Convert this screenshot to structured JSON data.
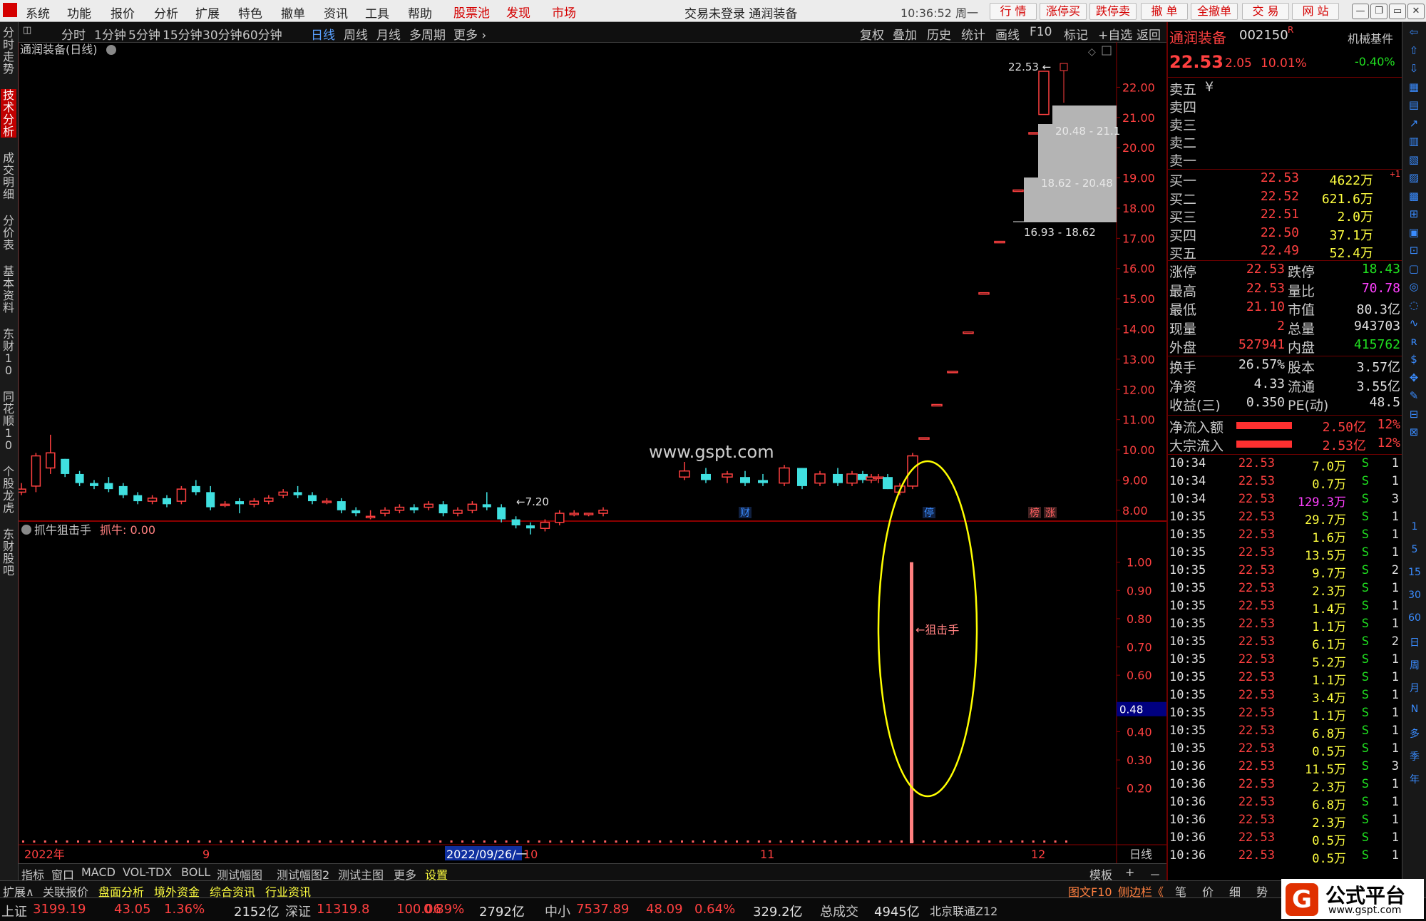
{
  "menubar": {
    "items": [
      "系统",
      "功能",
      "报价",
      "分析",
      "扩展",
      "特色",
      "撤单",
      "资讯",
      "工具",
      "帮助"
    ],
    "red_items": [
      "股票池",
      "发现",
      "市场"
    ],
    "title": "交易未登录  通润装备",
    "clock": "10:36:52 周一",
    "buttons": [
      "行 情",
      "涨停买",
      "跌停卖",
      "撤 单",
      "全撤单",
      "交 易",
      "网 站"
    ],
    "win_buttons": [
      "—",
      "❐",
      "▭",
      "✕"
    ]
  },
  "left_tabs": [
    "分时走势",
    "技术分析",
    "成交明细",
    "分价表",
    "基本资料",
    "东财10",
    "同花顺10",
    "个股龙虎",
    "东财股吧"
  ],
  "periods": [
    "分时",
    "1分钟",
    "5分钟",
    "15分钟",
    "30分钟",
    "60分钟",
    "日线",
    "周线",
    "月线",
    "多周期",
    "更多"
  ],
  "active_period": "日线",
  "chart_tools": [
    "复权",
    "叠加",
    "历史",
    "统计",
    "画线",
    "F10",
    "标记",
    "+自选",
    "返回"
  ],
  "chart_data": [
    {
      "type": "candlestick",
      "title": "通润装备(日线)",
      "ylim": [
        7.5,
        22.6
      ],
      "yticks": [
        "22.00",
        "21.00",
        "20.00",
        "19.00",
        "18.00",
        "17.00",
        "16.00",
        "15.00",
        "14.00",
        "13.00",
        "12.00",
        "11.00",
        "10.00",
        "9.00",
        "8.00"
      ],
      "annotations": {
        "high": "22.53",
        "low": "7.20",
        "box1": "20.48 - 21.1",
        "box2": "18.62 - 20.48",
        "box3": "16.93 - 18.62",
        "watermark": "www.gspt.com"
      },
      "markers": [
        "财",
        "停",
        "榜",
        "涨"
      ],
      "candles": [
        [
          8.6,
          8.9,
          8.5,
          8.7
        ],
        [
          8.8,
          9.9,
          8.6,
          9.8
        ],
        [
          9.4,
          10.5,
          9.2,
          9.9
        ],
        [
          9.7,
          9.7,
          9.1,
          9.2
        ],
        [
          9.2,
          9.3,
          8.8,
          8.9
        ],
        [
          8.9,
          9.0,
          8.7,
          8.8
        ],
        [
          8.9,
          9.1,
          8.6,
          8.7
        ],
        [
          8.8,
          8.9,
          8.4,
          8.5
        ],
        [
          8.5,
          8.6,
          8.2,
          8.3
        ],
        [
          8.3,
          8.5,
          8.2,
          8.4
        ],
        [
          8.4,
          8.5,
          8.1,
          8.2
        ],
        [
          8.3,
          8.8,
          8.2,
          8.7
        ],
        [
          8.8,
          9.0,
          8.5,
          8.6
        ],
        [
          8.6,
          8.8,
          8.0,
          8.1
        ],
        [
          8.2,
          8.3,
          8.1,
          8.2
        ],
        [
          8.3,
          8.4,
          7.9,
          8.2
        ],
        [
          8.2,
          8.4,
          8.1,
          8.3
        ],
        [
          8.3,
          8.5,
          8.2,
          8.4
        ],
        [
          8.5,
          8.7,
          8.4,
          8.6
        ],
        [
          8.6,
          8.8,
          8.4,
          8.5
        ],
        [
          8.5,
          8.6,
          8.2,
          8.3
        ],
        [
          8.3,
          8.4,
          8.2,
          8.3
        ],
        [
          8.3,
          8.4,
          7.9,
          8.0
        ],
        [
          8.0,
          8.1,
          7.8,
          7.9
        ],
        [
          7.8,
          8.0,
          7.7,
          7.8
        ],
        [
          7.9,
          8.1,
          7.8,
          8.0
        ],
        [
          8.0,
          8.2,
          7.9,
          8.1
        ],
        [
          8.1,
          8.2,
          7.9,
          8.0
        ],
        [
          8.1,
          8.3,
          8.0,
          8.2
        ],
        [
          8.2,
          8.3,
          7.8,
          7.9
        ],
        [
          7.9,
          8.1,
          7.8,
          8.0
        ],
        [
          8.0,
          8.3,
          7.9,
          8.2
        ],
        [
          8.2,
          8.6,
          8.0,
          8.1
        ],
        [
          8.1,
          8.2,
          7.6,
          7.7
        ],
        [
          7.7,
          7.8,
          7.4,
          7.5
        ],
        [
          7.5,
          7.6,
          7.2,
          7.4
        ],
        [
          7.4,
          7.7,
          7.3,
          7.6
        ],
        [
          7.6,
          8.0,
          7.5,
          7.9
        ],
        [
          7.9,
          8.0,
          7.8,
          7.9
        ],
        [
          7.9,
          7.9,
          7.8,
          7.9
        ],
        [
          7.9,
          8.1,
          7.8,
          8.0
        ]
      ],
      "candles2": [
        [
          9.1,
          9.6,
          9.0,
          9.3
        ],
        [
          9.2,
          9.4,
          8.9,
          9.0
        ],
        [
          9.1,
          9.3,
          8.9,
          9.2
        ],
        [
          9.1,
          9.3,
          8.8,
          8.9
        ],
        [
          9.0,
          9.2,
          8.8,
          8.9
        ],
        [
          8.9,
          9.5,
          8.8,
          9.4
        ],
        [
          9.4,
          9.4,
          8.7,
          8.8
        ],
        [
          8.9,
          9.3,
          8.8,
          9.2
        ],
        [
          9.2,
          9.4,
          8.8,
          8.9
        ],
        [
          8.9,
          9.3,
          8.8,
          9.2
        ],
        [
          9.2,
          9.3,
          8.9,
          9.0
        ],
        [
          9.0,
          9.2,
          8.9,
          9.1
        ],
        [
          9.1,
          9.2,
          8.9,
          9.1
        ],
        [
          9.1,
          9.2,
          8.7,
          8.7
        ],
        [
          8.6,
          8.9,
          8.5,
          8.8
        ],
        [
          8.8,
          9.9,
          8.7,
          9.8
        ],
        [
          10.4,
          10.4,
          10.4,
          10.4
        ],
        [
          11.5,
          11.5,
          11.5,
          11.5
        ],
        [
          12.6,
          12.6,
          12.6,
          12.6
        ],
        [
          13.9,
          13.9,
          13.9,
          13.9
        ],
        [
          15.2,
          15.2,
          15.2,
          15.2
        ],
        [
          16.9,
          16.9,
          16.9,
          16.9
        ],
        [
          18.6,
          18.6,
          18.6,
          18.6
        ],
        [
          20.5,
          20.5,
          20.5,
          20.5
        ],
        [
          21.1,
          22.53,
          21.1,
          22.53
        ]
      ]
    },
    {
      "type": "bar",
      "title": "抓牛狙击手",
      "series_label": "抓牛: 0.00",
      "ylim": [
        0,
        1.1
      ],
      "yticks": [
        "1.00",
        "0.90",
        "0.80",
        "0.70",
        "0.60",
        "0.40",
        "0.30",
        "0.20"
      ],
      "current_value": "0.48",
      "signal_value": 1.0,
      "signal_label": "←狙击手",
      "xlabels": [
        "2022年",
        "9",
        "2022/09/26/一",
        "10",
        "11",
        "12"
      ],
      "subchart_label": "日线"
    }
  ],
  "quote": {
    "name": "通润装备",
    "code": "002150",
    "code_flag": "R",
    "sector": "机械基件",
    "sector_change": "-0.40%",
    "price": "22.53",
    "change": "2.05",
    "pct": "10.01%",
    "asks": [
      {
        "l": "卖五",
        "p": "",
        "v": "¥"
      },
      {
        "l": "卖四",
        "p": "",
        "v": ""
      },
      {
        "l": "卖三",
        "p": "",
        "v": ""
      },
      {
        "l": "卖二",
        "p": "",
        "v": ""
      },
      {
        "l": "卖一",
        "p": "",
        "v": ""
      }
    ],
    "bids": [
      {
        "l": "买一",
        "p": "22.53",
        "v": "4622万",
        "x": "+1"
      },
      {
        "l": "买二",
        "p": "22.52",
        "v": "621.6万",
        "x": ""
      },
      {
        "l": "买三",
        "p": "22.51",
        "v": "2.0万",
        "x": ""
      },
      {
        "l": "买四",
        "p": "22.50",
        "v": "37.1万",
        "x": ""
      },
      {
        "l": "买五",
        "p": "22.49",
        "v": "52.4万",
        "x": ""
      }
    ],
    "stats": [
      {
        "l1": "涨停",
        "v1": "22.53",
        "l2": "跌停",
        "v2": "18.43"
      },
      {
        "l1": "最高",
        "v1": "22.53",
        "l2": "量比",
        "v2": "70.78"
      },
      {
        "l1": "最低",
        "v1": "21.10",
        "l2": "市值",
        "v2": "80.3亿"
      },
      {
        "l1": "现量",
        "v1": "2",
        "l2": "总量",
        "v2": "943703"
      },
      {
        "l1": "外盘",
        "v1": "527941",
        "l2": "内盘",
        "v2": "415762"
      }
    ],
    "stats2": [
      {
        "l1": "换手",
        "v1": "26.57%",
        "l2": "股本",
        "v2": "3.57亿"
      },
      {
        "l1": "净资",
        "v1": "4.33",
        "l2": "流通",
        "v2": "3.55亿"
      },
      {
        "l1": "收益(三)",
        "v1": "0.350",
        "l2": "PE(动)",
        "v2": "48.5"
      }
    ],
    "flows": [
      {
        "l": "净流入额",
        "v": "2.50亿",
        "p": "12%"
      },
      {
        "l": "大宗流入",
        "v": "2.53亿",
        "p": "12%"
      }
    ],
    "ticks": [
      [
        "10:34",
        "22.53",
        "7.0万",
        "S",
        "1"
      ],
      [
        "10:34",
        "22.53",
        "0.7万",
        "S",
        "1"
      ],
      [
        "10:34",
        "22.53",
        "129.3万",
        "S",
        "3"
      ],
      [
        "10:35",
        "22.53",
        "29.7万",
        "S",
        "1"
      ],
      [
        "10:35",
        "22.53",
        "1.6万",
        "S",
        "1"
      ],
      [
        "10:35",
        "22.53",
        "13.5万",
        "S",
        "1"
      ],
      [
        "10:35",
        "22.53",
        "9.7万",
        "S",
        "2"
      ],
      [
        "10:35",
        "22.53",
        "2.3万",
        "S",
        "1"
      ],
      [
        "10:35",
        "22.53",
        "1.4万",
        "S",
        "1"
      ],
      [
        "10:35",
        "22.53",
        "1.1万",
        "S",
        "1"
      ],
      [
        "10:35",
        "22.53",
        "6.1万",
        "S",
        "2"
      ],
      [
        "10:35",
        "22.53",
        "5.2万",
        "S",
        "1"
      ],
      [
        "10:35",
        "22.53",
        "1.1万",
        "S",
        "1"
      ],
      [
        "10:35",
        "22.53",
        "3.4万",
        "S",
        "1"
      ],
      [
        "10:35",
        "22.53",
        "1.1万",
        "S",
        "1"
      ],
      [
        "10:35",
        "22.53",
        "6.8万",
        "S",
        "1"
      ],
      [
        "10:35",
        "22.53",
        "0.5万",
        "S",
        "1"
      ],
      [
        "10:36",
        "22.53",
        "11.5万",
        "S",
        "3"
      ],
      [
        "10:36",
        "22.53",
        "2.3万",
        "S",
        "1"
      ],
      [
        "10:36",
        "22.53",
        "6.8万",
        "S",
        "1"
      ],
      [
        "10:36",
        "22.53",
        "2.3万",
        "S",
        "1"
      ],
      [
        "10:36",
        "22.53",
        "0.5万",
        "S",
        "1"
      ],
      [
        "10:36",
        "22.53",
        "0.5万",
        "S",
        "1"
      ]
    ]
  },
  "bottom_tabs": [
    "指标",
    "窗口",
    "MACD",
    "VOL-TDX",
    "BOLL",
    "测试幅图",
    "测试幅图2",
    "测试主图",
    "更多",
    "设置"
  ],
  "bottom_right": [
    "模板",
    "+",
    "－"
  ],
  "bottom_tabs2": [
    "扩展∧",
    "关联报价",
    "盘面分析",
    "境外资金",
    "综合资讯",
    "行业资讯"
  ],
  "bottom_right2": [
    "图文F10",
    "侧边栏《"
  ],
  "panel_tabs": [
    "笔",
    "价",
    "细",
    "势"
  ],
  "right_nums": [
    "1",
    "5",
    "15",
    "30",
    "60",
    "日",
    "周",
    "月",
    "N",
    "多",
    "季",
    "年"
  ],
  "status": {
    "sh_label": "上证",
    "sh_val": "3199.19",
    "sh_chg": "43.05",
    "sh_pct": "1.36%",
    "sh_amt": "2152亿",
    "sz_label": "深证",
    "sz_val": "11319.8",
    "sz_chg": "100.06",
    "sz_pct": "0.89%",
    "sz_amt": "2792亿",
    "zx_label": "中小",
    "zx_val": "7537.89",
    "zx_chg": "48.09",
    "zx_pct": "0.64%",
    "zx_amt": "329.2亿",
    "total_label": "总成交",
    "total_val": "4945亿",
    "bj": "北京联通Z12"
  },
  "logo": {
    "text": "公式平台",
    "url": "www.gspt.com"
  },
  "colors": {
    "up": "#ff4040",
    "down": "#40e0e0",
    "signal": "#ff8080",
    "ellipse": "#ffff00"
  }
}
